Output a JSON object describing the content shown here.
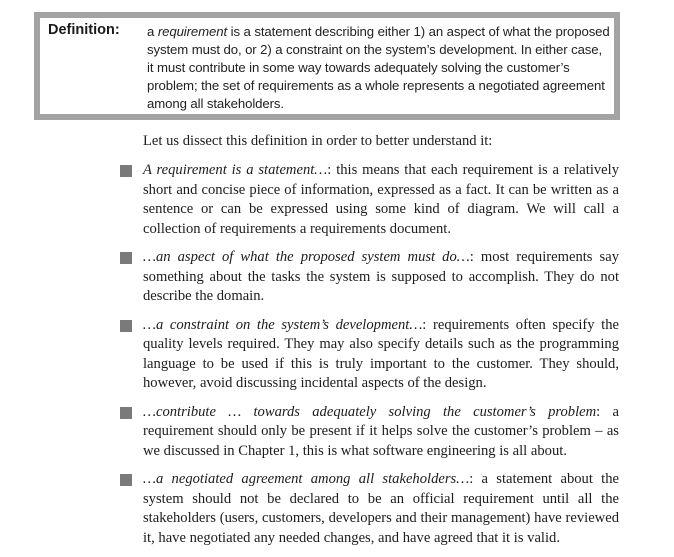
{
  "definition": {
    "label": "Definition:",
    "text_before": "a ",
    "term": "requirement",
    "text_after": " is a statement describing either 1) an aspect of what the proposed system must do, or 2) a constraint on the system’s development. In either case, it must contribute in some way towards adequately solving the customer’s problem; the set of requirements as a whole represents a negotiated agreement among all stakeholders."
  },
  "intro": "Let us dissect this definition in order to better understand it:",
  "bullets": [
    {
      "lead": "A requirement is a statement…",
      "text": ": this means that each requirement is a relatively short and concise piece of information, expressed as a fact. It can be written as a sentence or can be expressed using some kind of diagram. We will call a collection of requirements a requirements document."
    },
    {
      "lead": "…an aspect of what the proposed system must do…",
      "text": ": most requirements say something about the tasks the system is supposed to accomplish. They do not describe the domain."
    },
    {
      "lead": "…a constraint on the system’s development…",
      "text": ": requirements often specify the quality levels required. They may also specify details such as the programming language to be used if this is truly important to the customer. They should, however, avoid discussing incidental aspects of the design."
    },
    {
      "lead": "…contribute … towards adequately solving the customer’s problem",
      "text": ": a requirement should only be present if it helps solve the customer’s problem – as we discussed in Chapter 1, this is what software engineering is all about."
    },
    {
      "lead": "…a negotiated agreement among all stakeholders…",
      "text": ": a statement about the system should not be declared to be an official requirement until all the stakeholders (users, customers, developers and their management) have reviewed it, have negotiated any needed changes, and have agreed that it is valid."
    }
  ],
  "colors": {
    "box_border": "#a3a3a3",
    "bullet_marker": "#7a7a7a",
    "text": "#1c1c1c"
  }
}
